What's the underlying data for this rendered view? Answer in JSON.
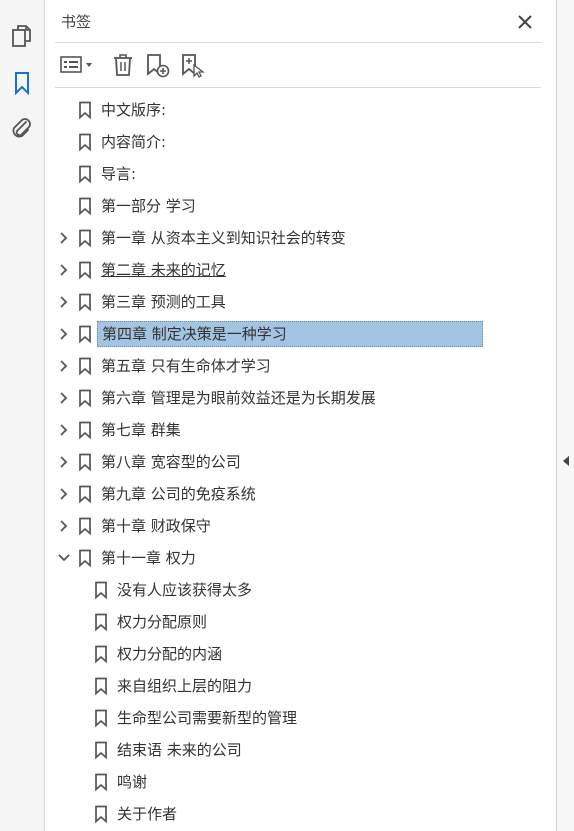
{
  "panel": {
    "title": "书签"
  },
  "bookmarks": [
    {
      "label": "中文版序:",
      "expander": "none",
      "level": 0
    },
    {
      "label": "内容简介:",
      "expander": "none",
      "level": 0
    },
    {
      "label": "导言:",
      "expander": "none",
      "level": 0
    },
    {
      "label": "第一部分  学习",
      "expander": "none",
      "level": 0
    },
    {
      "label": "第一章  从资本主义到知识社会的转变",
      "expander": "collapsed",
      "level": 0
    },
    {
      "label": "第二章  未来的记忆",
      "expander": "collapsed",
      "level": 0,
      "underlined": true
    },
    {
      "label": "第三章  预测的工具",
      "expander": "collapsed",
      "level": 0
    },
    {
      "label": "第四章  制定决策是一种学习",
      "expander": "collapsed",
      "level": 0,
      "selected": true
    },
    {
      "label": "第五章  只有生命体才学习",
      "expander": "collapsed",
      "level": 0
    },
    {
      "label": "第六章  管理是为眼前效益还是为长期发展",
      "expander": "collapsed",
      "level": 0
    },
    {
      "label": "第七章  群集",
      "expander": "collapsed",
      "level": 0
    },
    {
      "label": "第八章  宽容型的公司",
      "expander": "collapsed",
      "level": 0
    },
    {
      "label": "第九章  公司的免疫系统",
      "expander": "collapsed",
      "level": 0
    },
    {
      "label": "第十章  财政保守",
      "expander": "collapsed",
      "level": 0
    },
    {
      "label": "第十一章  权力",
      "expander": "expanded",
      "level": 0
    },
    {
      "label": "没有人应该获得太多",
      "expander": "none",
      "level": 1
    },
    {
      "label": "权力分配原则",
      "expander": "none",
      "level": 1
    },
    {
      "label": "权力分配的内涵",
      "expander": "none",
      "level": 1
    },
    {
      "label": "来自组织上层的阻力",
      "expander": "none",
      "level": 1
    },
    {
      "label": "生命型公司需要新型的管理",
      "expander": "none",
      "level": 1
    },
    {
      "label": "结束语  未来的公司",
      "expander": "none",
      "level": 1
    },
    {
      "label": "鸣谢",
      "expander": "none",
      "level": 1
    },
    {
      "label": "关于作者",
      "expander": "none",
      "level": 1
    }
  ],
  "colors": {
    "accent": "#1a73c8",
    "selection": "#a3c4e3",
    "icon": "#555555"
  },
  "icons": {
    "rail": [
      "pages-icon",
      "bookmark-icon",
      "attachment-icon"
    ],
    "toolbar": [
      "options-menu-icon",
      "delete-icon",
      "new-bookmark-icon",
      "bookmark-from-selection-icon"
    ]
  }
}
